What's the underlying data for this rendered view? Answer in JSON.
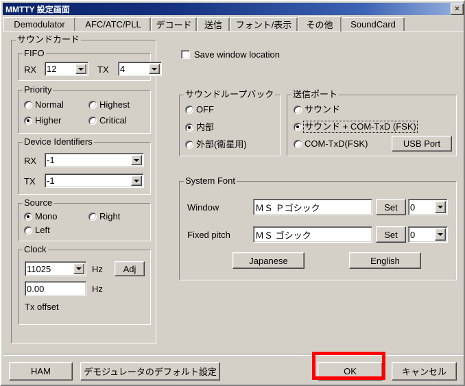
{
  "window": {
    "title": "MMTTY 設定画面",
    "close_label": "✕"
  },
  "tabs": [
    {
      "label": "Demodulator",
      "active": false
    },
    {
      "label": "AFC/ATC/PLL",
      "active": false
    },
    {
      "label": "デコード",
      "active": false
    },
    {
      "label": "送信",
      "active": false
    },
    {
      "label": "フォント/表示",
      "active": false
    },
    {
      "label": "その他",
      "active": true
    },
    {
      "label": "SoundCard",
      "active": false
    }
  ],
  "soundcard": {
    "group_label": "サウンドカード",
    "fifo": {
      "group_label": "FIFO",
      "rx_label": "RX",
      "rx_value": "12",
      "tx_label": "TX",
      "tx_value": "4"
    },
    "priority": {
      "group_label": "Priority",
      "options": [
        {
          "label": "Normal",
          "selected": false
        },
        {
          "label": "Highest",
          "selected": false
        },
        {
          "label": "Higher",
          "selected": true
        },
        {
          "label": "Critical",
          "selected": false
        }
      ]
    },
    "device_identifiers": {
      "group_label": "Device Identifiers",
      "rx_label": "RX",
      "rx_value": "-1",
      "tx_label": "TX",
      "tx_value": "-1"
    },
    "source": {
      "group_label": "Source",
      "options": [
        {
          "label": "Mono",
          "selected": true
        },
        {
          "label": "Right",
          "selected": false
        },
        {
          "label": "Left",
          "selected": false
        }
      ]
    },
    "clock": {
      "group_label": "Clock",
      "rate_value": "11025",
      "rate_unit": "Hz",
      "adj_label": "Adj",
      "offset_value": "0.00",
      "offset_unit": "Hz",
      "offset_caption": "Tx offset"
    }
  },
  "options": {
    "save_window_location": {
      "label": "Save window location",
      "checked": false
    }
  },
  "loopback": {
    "group_label": "サウンドループバック",
    "options": [
      {
        "label": "OFF",
        "selected": false
      },
      {
        "label": "内部",
        "selected": true
      },
      {
        "label": "外部(衛星用)",
        "selected": false
      }
    ]
  },
  "tx_port": {
    "group_label": "送信ポート",
    "options": [
      {
        "label": "サウンド",
        "selected": false,
        "focused": false
      },
      {
        "label": "サウンド + COM-TxD (FSK)",
        "selected": true,
        "focused": true
      },
      {
        "label": "COM-TxD(FSK)",
        "selected": false,
        "focused": false
      }
    ],
    "usb_port_label": "USB Port"
  },
  "system_font": {
    "group_label": "System Font",
    "window_label": "Window",
    "window_value": "ＭＳ Ｐゴシック",
    "window_set_label": "Set",
    "window_size": "0",
    "fixed_label": "Fixed pitch",
    "fixed_value": "ＭＳ ゴシック",
    "fixed_set_label": "Set",
    "fixed_size": "0",
    "japanese_label": "Japanese",
    "english_label": "English"
  },
  "footer": {
    "ham_label": "HAM",
    "demod_default_label": "デモジュレータのデフォルト設定",
    "ok_label": "OK",
    "cancel_label": "キャンセル"
  },
  "annotation": {
    "highlight_color": "#ff0000",
    "target": "ok-button"
  }
}
